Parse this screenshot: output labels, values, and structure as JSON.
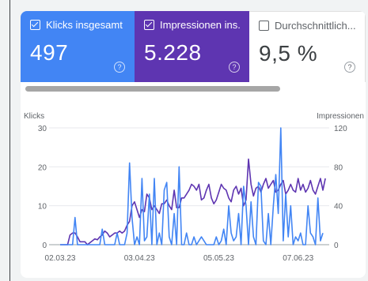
{
  "metrics": [
    {
      "label": "Klicks insgesamt",
      "value": "497",
      "checked": true
    },
    {
      "label": "Impressionen ins...",
      "value": "5.228",
      "checked": true
    },
    {
      "label": "Durchschnittlich...",
      "value": "9,5 %",
      "checked": false
    }
  ],
  "help_glyph": "?",
  "colors": {
    "clicks": "#4285f4",
    "impressions": "#5e35b1",
    "grid": "#e8eaed",
    "text": "#5f6368"
  },
  "chart_data": {
    "type": "line",
    "left_axis_title": "Klicks",
    "right_axis_title": "Impressionen",
    "left_ticks": [
      "30",
      "20",
      "10",
      "0"
    ],
    "right_ticks": [
      "120",
      "80",
      "40",
      "0"
    ],
    "left_ylim": [
      0,
      30
    ],
    "right_ylim": [
      0,
      120
    ],
    "x_tick_labels": [
      "02.03.23",
      "03.04.23",
      "05.05.23",
      "07.06.23"
    ],
    "x_tick_indices": [
      0,
      32,
      64,
      96
    ],
    "series": [
      {
        "name": "Klicks",
        "axis": "left",
        "values": [
          0,
          0,
          0,
          0,
          0,
          0,
          7,
          0,
          0,
          0,
          0,
          0,
          0,
          0,
          0,
          0,
          0,
          4,
          0,
          0,
          0,
          0,
          0,
          3,
          0,
          0,
          0,
          3,
          21,
          7,
          0,
          2,
          0,
          17,
          1,
          2,
          13,
          0,
          17,
          0,
          3,
          0,
          14,
          16,
          2,
          0,
          8,
          0,
          20,
          0,
          0,
          3,
          0,
          0,
          2,
          0,
          1,
          2,
          1,
          0,
          0,
          0,
          0,
          2,
          0,
          1,
          4,
          0,
          10,
          3,
          1,
          2,
          8,
          0,
          15,
          10,
          0,
          11,
          2,
          0,
          16,
          15,
          1,
          0,
          8,
          0,
          10,
          18,
          8,
          30,
          1,
          13,
          2,
          10,
          0,
          2,
          1,
          3,
          0,
          0,
          10,
          3,
          2,
          0,
          12,
          1,
          3
        ]
      },
      {
        "name": "Impressionen",
        "axis": "right",
        "values": [
          0,
          0,
          0,
          0,
          10,
          12,
          12,
          8,
          3,
          3,
          3,
          0,
          2,
          4,
          6,
          5,
          8,
          10,
          14,
          12,
          8,
          10,
          12,
          12,
          14,
          12,
          14,
          20,
          24,
          40,
          44,
          36,
          28,
          36,
          34,
          52,
          48,
          36,
          40,
          36,
          32,
          42,
          42,
          46,
          40,
          36,
          56,
          38,
          38,
          48,
          48,
          52,
          56,
          62,
          60,
          56,
          62,
          46,
          48,
          56,
          62,
          48,
          42,
          46,
          54,
          62,
          58,
          56,
          48,
          44,
          56,
          60,
          52,
          58,
          40,
          46,
          88,
          62,
          50,
          58,
          60,
          54,
          62,
          68,
          58,
          62,
          66,
          54,
          56,
          62,
          66,
          52,
          56,
          62,
          56,
          54,
          68,
          56,
          62,
          54,
          58,
          66,
          56,
          52,
          60,
          68,
          56,
          68
        ]
      }
    ]
  }
}
